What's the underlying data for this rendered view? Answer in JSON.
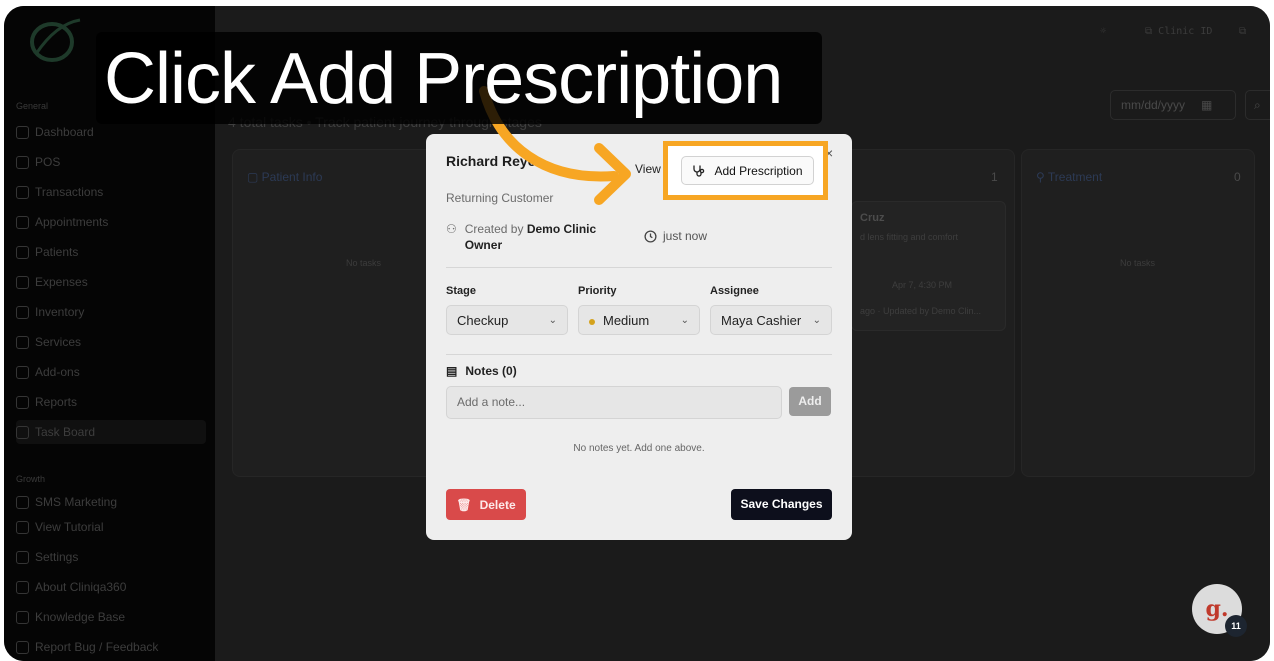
{
  "caption": "Click Add Prescription",
  "sidebar": {
    "sections": [
      "General",
      "Growth"
    ],
    "items": [
      {
        "label": "Dashboard"
      },
      {
        "label": "POS"
      },
      {
        "label": "Transactions"
      },
      {
        "label": "Appointments"
      },
      {
        "label": "Patients"
      },
      {
        "label": "Expenses"
      },
      {
        "label": "Inventory"
      },
      {
        "label": "Services"
      },
      {
        "label": "Add-ons"
      },
      {
        "label": "Reports"
      },
      {
        "label": "Task Board"
      }
    ],
    "growth_items": [
      {
        "label": "SMS Marketing"
      }
    ],
    "footer_items": [
      {
        "label": "View Tutorial"
      },
      {
        "label": "Settings"
      },
      {
        "label": "About Cliniqa360"
      },
      {
        "label": "Knowledge Base"
      },
      {
        "label": "Report Bug / Feedback"
      }
    ]
  },
  "topbar": {
    "clinic_id_label": "Clinic ID"
  },
  "board": {
    "subtitle": "4 total tasks • Track patient journey through stages",
    "date_placeholder": "mm/dd/yyyy",
    "columns": [
      {
        "title": "Patient Info",
        "empty": "No tasks"
      },
      {
        "title": "",
        "count": "1"
      },
      {
        "title": "Treatment",
        "count": "0",
        "empty": "No tasks"
      }
    ],
    "card": {
      "title": "Cruz",
      "line1": "d lens fitting and comfort",
      "date": "Apr 7, 4:30 PM",
      "footer": "ago · Updated by Demo Clin..."
    }
  },
  "modal": {
    "patient_name": "Richard Reyes",
    "customer_type": "Returning Customer",
    "view_label": "View",
    "add_prescription_label": "Add Prescription",
    "close": "×",
    "created_by_prefix": "Created by",
    "created_by_name": "Demo Clinic Owner",
    "time": "just now",
    "stage_label": "Stage",
    "stage_value": "Checkup",
    "priority_label": "Priority",
    "priority_value": "Medium",
    "assignee_label": "Assignee",
    "assignee_value": "Maya Cashier",
    "notes_title": "Notes (0)",
    "note_placeholder": "Add a note...",
    "add_label": "Add",
    "empty_notes": "No notes yet. Add one above.",
    "delete_label": "Delete",
    "save_label": "Save Changes"
  },
  "chat": {
    "glyph": "g.",
    "badge": "11"
  },
  "colors": {
    "highlight": "#f7a623",
    "delete": "#d94a4a",
    "save": "#0d0f1c",
    "priority_dot": "#d4a21c"
  }
}
